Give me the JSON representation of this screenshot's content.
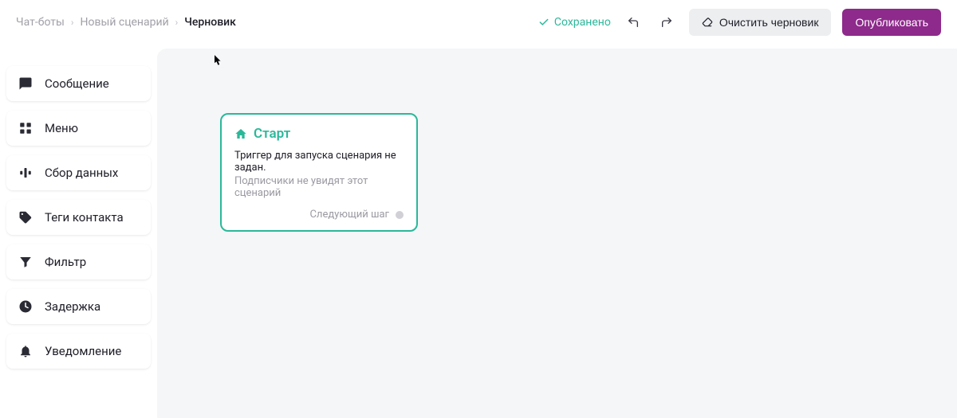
{
  "breadcrumb": {
    "item1": "Чат-боты",
    "item2": "Новый сценарий",
    "item3": "Черновик"
  },
  "header": {
    "saved_label": "Сохранено",
    "clear_label": "Очистить черновик",
    "publish_label": "Опубликовать"
  },
  "sidebar": {
    "items": [
      {
        "label": "Сообщение"
      },
      {
        "label": "Меню"
      },
      {
        "label": "Сбор данных"
      },
      {
        "label": "Теги контакта"
      },
      {
        "label": "Фильтр"
      },
      {
        "label": "Задержка"
      },
      {
        "label": "Уведомление"
      }
    ]
  },
  "start_node": {
    "title": "Старт",
    "line1": "Триггер для запуска сценария не задан.",
    "line2": "Подписчики не увидят этот сценарий",
    "next_label": "Следующий шаг"
  }
}
